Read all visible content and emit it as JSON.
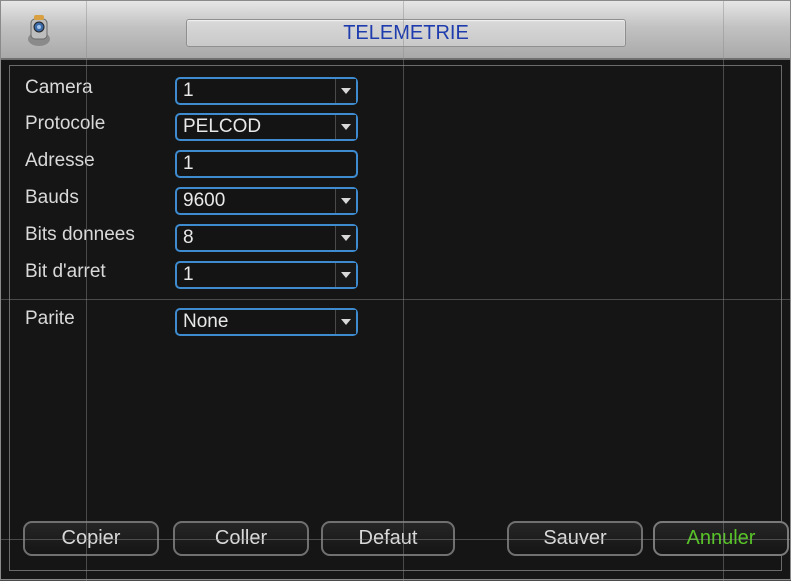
{
  "window": {
    "title": "TELEMETRIE",
    "icon": "camera-icon"
  },
  "fields": [
    {
      "label": "Camera",
      "value": "1",
      "dropdown": true
    },
    {
      "label": "Protocole",
      "value": "PELCOD",
      "dropdown": true
    },
    {
      "label": "Adresse",
      "value": "1",
      "dropdown": false
    },
    {
      "label": "Bauds",
      "value": "9600",
      "dropdown": true
    },
    {
      "label": "Bits donnees",
      "value": "8",
      "dropdown": true
    },
    {
      "label": "Bit d'arret",
      "value": "1",
      "dropdown": true
    },
    {
      "label": "Parite",
      "value": "None",
      "dropdown": true
    }
  ],
  "buttons": {
    "copy": "Copier",
    "paste": "Coller",
    "default": "Defaut",
    "save": "Sauver",
    "cancel": "Annuler"
  },
  "colors": {
    "title_text": "#1f3cae",
    "field_border": "#3e8bd0",
    "cancel_text": "#58c428",
    "background": "#151515"
  }
}
